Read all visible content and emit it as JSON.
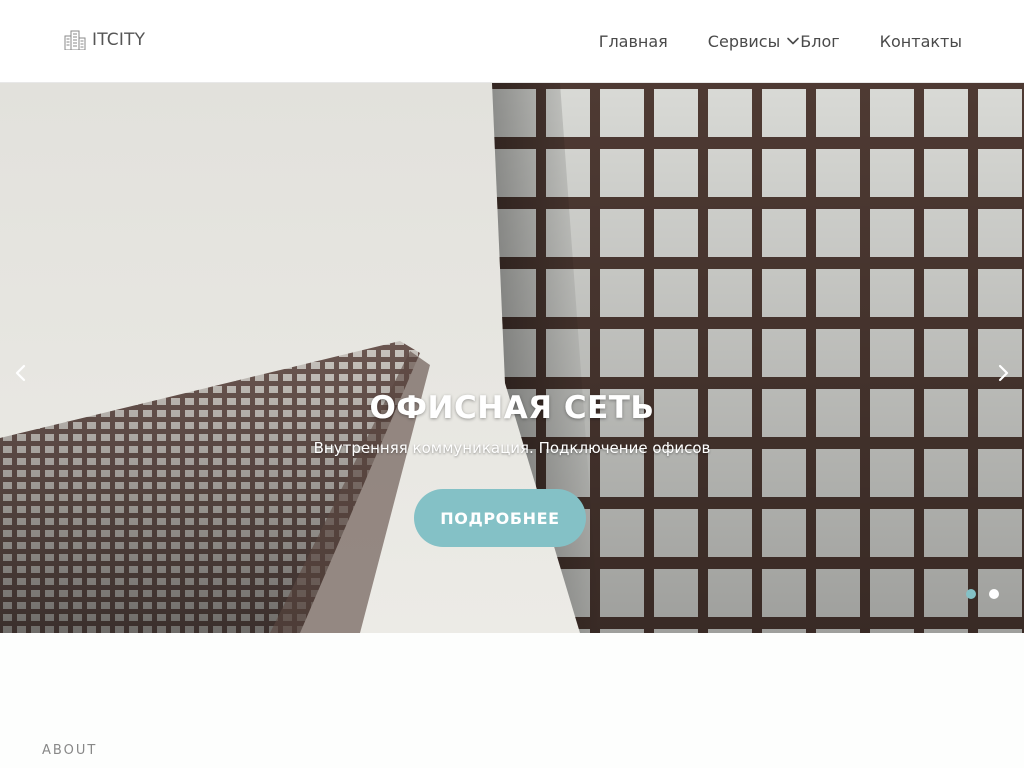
{
  "header": {
    "logo_text": "ITCITY",
    "logo_icon": "building-icon"
  },
  "nav": {
    "items": [
      {
        "label": "Главная"
      },
      {
        "label": "Сервисы",
        "has_dropdown": true
      },
      {
        "label": "Блог"
      },
      {
        "label": "Контакты"
      }
    ]
  },
  "slider": {
    "title": "ОФИСНАЯ СЕТЬ",
    "subtitle": "Внутренняя коммуникация. Подключение офисов",
    "button_label": "ПОДРОБНЕЕ",
    "slide_count": 2,
    "active_slide": 1,
    "prev_icon": "chevron-left-icon",
    "next_icon": "chevron-right-icon"
  },
  "about": {
    "label": "ABOUT"
  },
  "colors": {
    "accent": "#84c1c6",
    "nav_text": "#4a4a4a",
    "header_bg": "#ffffff"
  }
}
